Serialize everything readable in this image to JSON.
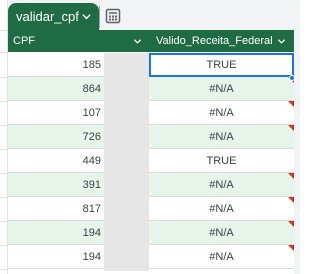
{
  "tab": {
    "label": "validar_cpf"
  },
  "columns": {
    "cpf": "CPF",
    "valid": "Valido_Receita_Federal"
  },
  "rows": [
    {
      "cpf": "185",
      "valid": "TRUE",
      "flag": false,
      "selected": true
    },
    {
      "cpf": "864",
      "valid": "#N/A",
      "flag": true,
      "selected": false
    },
    {
      "cpf": "107",
      "valid": "#N/A",
      "flag": true,
      "selected": false
    },
    {
      "cpf": "726",
      "valid": "#N/A",
      "flag": true,
      "selected": false
    },
    {
      "cpf": "449",
      "valid": "TRUE",
      "flag": false,
      "selected": false
    },
    {
      "cpf": "391",
      "valid": "#N/A",
      "flag": true,
      "selected": false
    },
    {
      "cpf": "817",
      "valid": "#N/A",
      "flag": true,
      "selected": false
    },
    {
      "cpf": "194",
      "valid": "#N/A",
      "flag": true,
      "selected": false
    },
    {
      "cpf": "194",
      "valid": "#N/A",
      "flag": true,
      "selected": false
    }
  ],
  "colors": {
    "header": "#1e6b44",
    "alt_row": "#e6f4ea",
    "selection": "#1a73e8",
    "error_flag": "#d93025"
  },
  "icons": {
    "tab_menu": "chevron-down-icon",
    "calculator": "calculator-icon",
    "column_filter": "chevron-down-icon"
  }
}
